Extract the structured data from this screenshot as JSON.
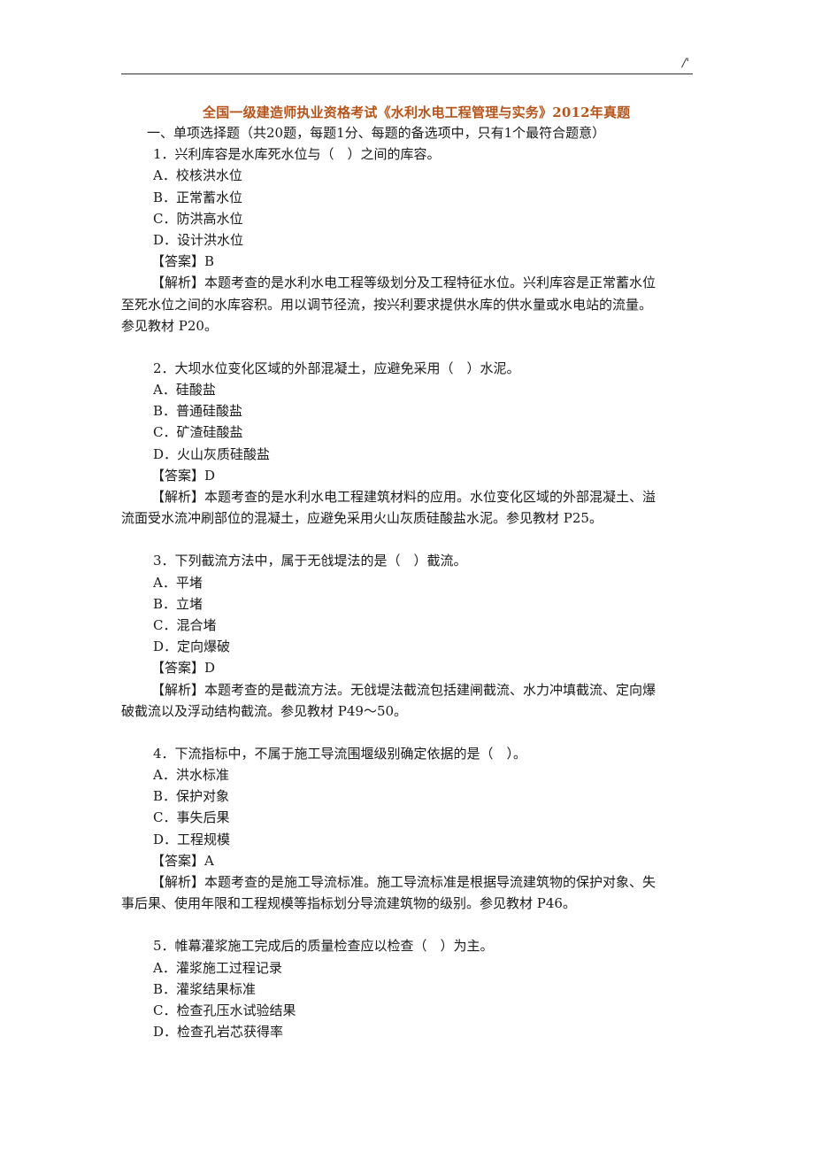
{
  "header": {
    "mark": "/'"
  },
  "title": "全国一级建造师执业资格考试《水利水电工程管理与实务》2012年真题",
  "section": "一、单项选择题（共20题，每题1分、每题的备选项中，只有1个最符合题意）",
  "questions": [
    {
      "stem": "1．兴利库容是水库死水位与（　）之间的库容。",
      "options": [
        "A．校核洪水位",
        "B．正常蓄水位",
        "C．防洪高水位",
        "D．设计洪水位"
      ],
      "answer": "【答案】B",
      "explanation_lines": [
        "【解析】本题考查的是水利水电工程等级划分及工程特征水位。兴利库容是正常蓄水位",
        "至死水位之间的水库容积。用以调节径流，按兴利要求提供水库的供水量或水电站的流量。",
        "参见教材 P20。"
      ]
    },
    {
      "stem": "2．大坝水位变化区域的外部混凝土，应避免采用（　）水泥。",
      "options": [
        "A．硅酸盐",
        "B．普通硅酸盐",
        "C．矿渣硅酸盐",
        "D．火山灰质硅酸盐"
      ],
      "answer": "【答案】D",
      "explanation_lines": [
        "【解析】本题考查的是水利水电工程建筑材料的应用。水位变化区域的外部混凝土、溢",
        "流面受水流冲刷部位的混凝土，应避免采用火山灰质硅酸盐水泥。参见教材 P25。"
      ]
    },
    {
      "stem": "3．下列截流方法中，属于无戗堤法的是（　）截流。",
      "options": [
        "A．平堵",
        "B．立堵",
        "C．混合堵",
        "D．定向爆破"
      ],
      "answer": "【答案】D",
      "explanation_lines": [
        "【解析】本题考查的是截流方法。无戗堤法截流包括建闸截流、水力冲填截流、定向爆",
        "破截流以及浮动结构截流。参见教材 P49～50。"
      ]
    },
    {
      "stem": "4．下流指标中，不属于施工导流围堰级别确定依据的是（　）。",
      "options": [
        "A．洪水标准",
        "B．保护对象",
        "C．事失后果",
        "D．工程规模"
      ],
      "answer": "【答案】A",
      "explanation_lines": [
        "【解析】本题考查的是施工导流标准。施工导流标准是根据导流建筑物的保护对象、失",
        "事后果、使用年限和工程规模等指标划分导流建筑物的级别。参见教材 P46。"
      ]
    },
    {
      "stem": "5．帷幕灌浆施工完成后的质量检查应以检查（　）为主。",
      "options": [
        "A．灌浆施工过程记录",
        "B．灌浆结果标准",
        "C．检查孔压水试验结果",
        "D．检查孔岩芯获得率"
      ],
      "answer": null,
      "explanation_lines": []
    }
  ]
}
